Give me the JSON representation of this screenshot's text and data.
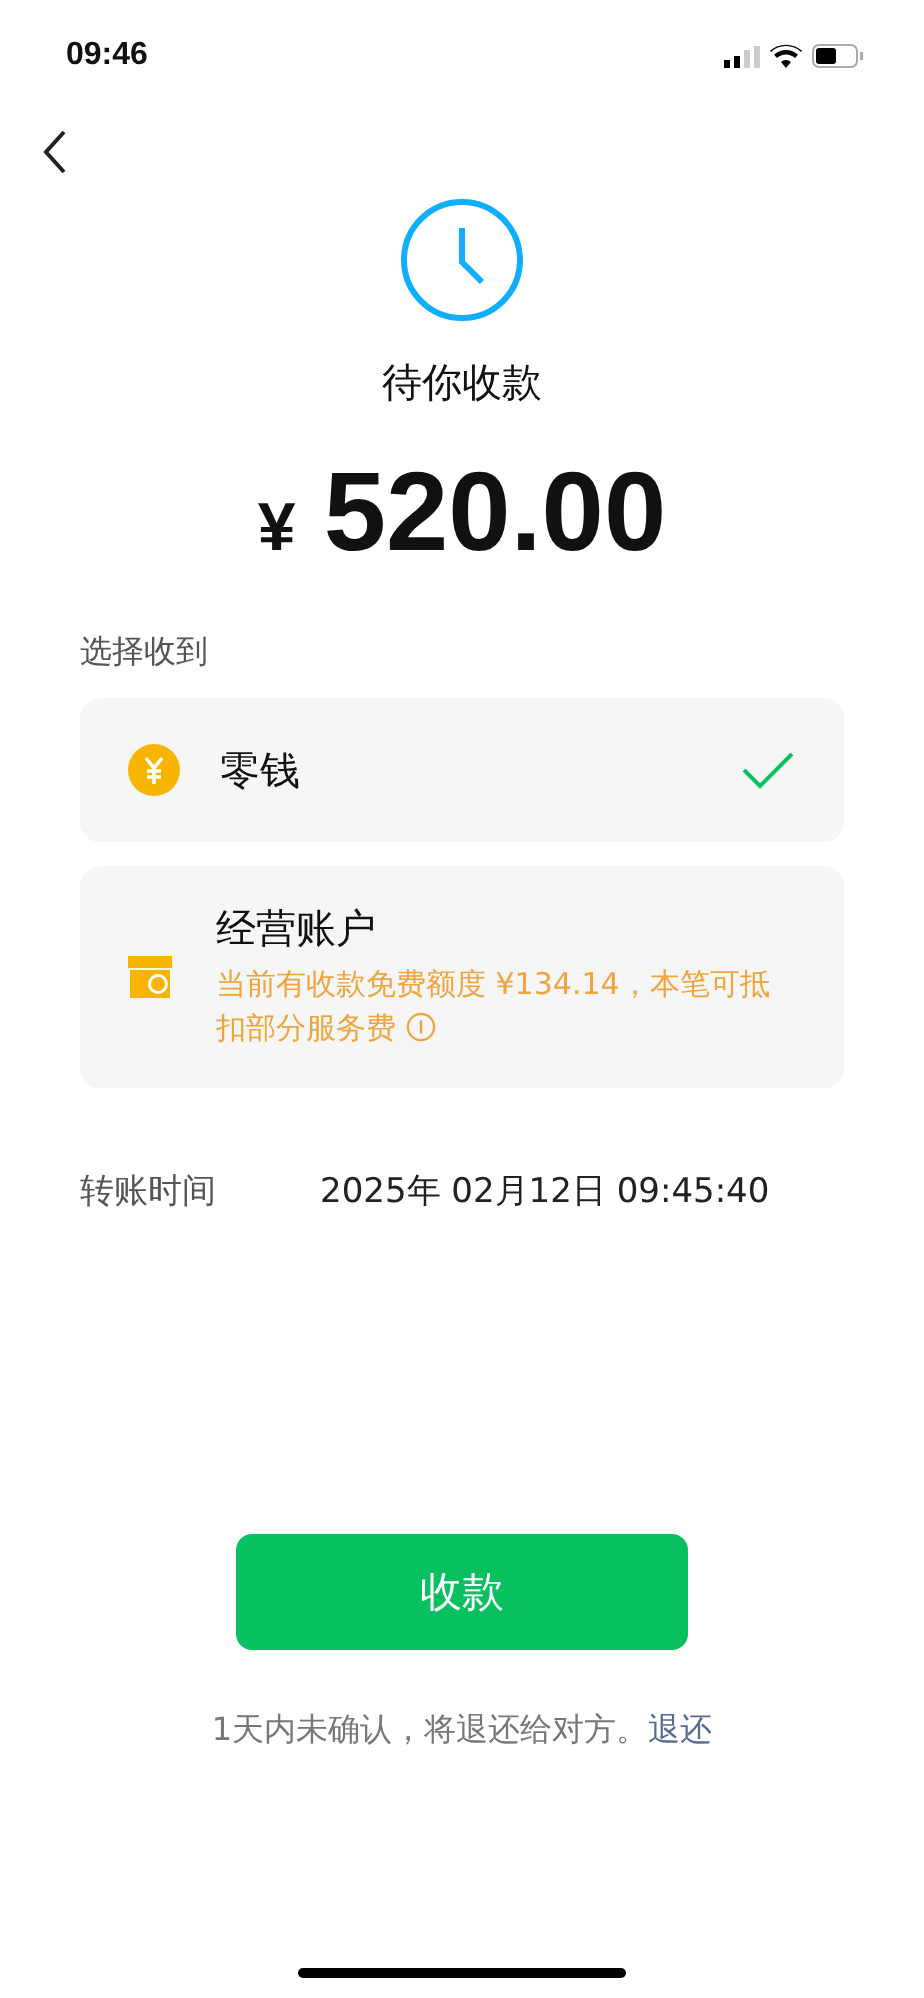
{
  "status_bar": {
    "time": "09:46"
  },
  "title": "待你收款",
  "amount": {
    "currency": "¥",
    "value": "520.00"
  },
  "section_label": "选择收到",
  "options": [
    {
      "kind": "change",
      "name": "零钱",
      "selected": true
    },
    {
      "kind": "business",
      "name": "经营账户",
      "note": "当前有收款免费额度 ¥134.14，本笔可抵扣部分服务费",
      "selected": false
    }
  ],
  "transfer_time": {
    "label": "转账时间",
    "value": "2025年 02月12日 09:45:40"
  },
  "confirm_button": "收款",
  "footer": {
    "text": "1天内未确认，将退还给对方。",
    "link": "退还"
  }
}
